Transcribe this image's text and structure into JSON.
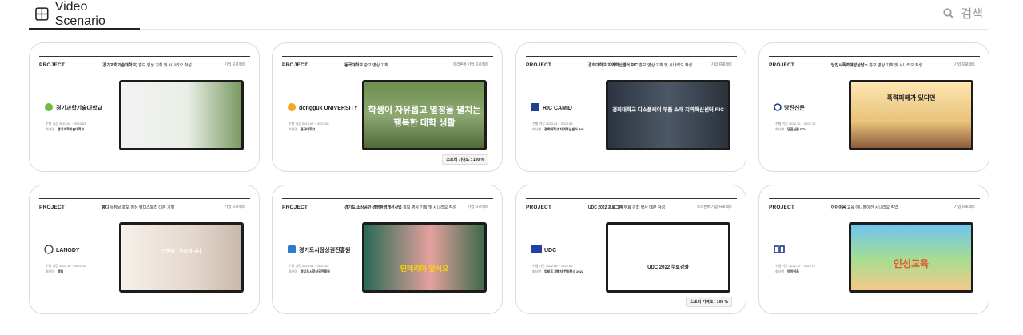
{
  "header": {
    "tab_label": "Video Scenario",
    "search_placeholder": "검색"
  },
  "cards": [
    {
      "project": "PROJECT",
      "title_bold": "[경기과학기술대학교]",
      "title_rest": " 홍보 영상 기획 및 시나리오 작성",
      "category": "기업 프로젝트",
      "logo_text": "경기과학기술대학교",
      "period": "수행 기간 2023.02 ~ 2023.03",
      "client_label": "회사명",
      "client": "경기과학기술대학교",
      "shot_text": "",
      "badge": ""
    },
    {
      "project": "PROJECT",
      "title_bold": "동국대학교",
      "title_rest": " 광고 영상 기획",
      "category": "트리온버 기업 프로젝트",
      "logo_text": "dongguk UNIVERSITY",
      "period": "수행 기간 2023.07 ~ 2023.08",
      "client_label": "회사명",
      "client": "동국대학교",
      "shot_text": "학생이 자유롭고 열정을 펼치는 행복한 대학 생활",
      "badge": "스토리 기여도 : 100 %"
    },
    {
      "project": "PROJECT",
      "title_bold": "경희대학교 지역혁신센터 RIC",
      "title_rest": " 홍보 영상 기획 및 시나리오 작성",
      "category": "기업 프로젝트",
      "logo_text": "RIC CAMID",
      "period": "수행 기간 2023.03 ~ 2023.03",
      "client_label": "회사명",
      "client": "경희대학교 지역혁신센터 RIC",
      "shot_text": "경희대학교 디스플레이 부품 소재 지역혁신센터 RIC",
      "badge": ""
    },
    {
      "project": "PROJECT",
      "title_bold": "당진시폭력예방상담소",
      "title_rest": " 홍보 영상 기획 및 시나리오 작성",
      "category": "기업 프로젝트",
      "logo_text": "당진신문",
      "period": "수행 기간 2022.10 ~ 2022.12",
      "client_label": "회사명",
      "client": "당진신문 DTV",
      "shot_text": "폭력피해가 있다면",
      "badge": ""
    },
    {
      "project": "PROJECT",
      "title_bold": "랭디",
      "title_rest": " 유튜브 홍보 영상 랭디스토리 대본 기획",
      "category": "기업 프로젝트",
      "logo_text": "LANGDY",
      "period": "수행 기간 2022.10 ~ 2022.11",
      "client_label": "회사명",
      "client": "랭디",
      "shot_text": "선생님 · 부모입니다",
      "badge": ""
    },
    {
      "project": "PROJECT",
      "title_bold": "경기도 소상공인 경영환경개선사업",
      "title_rest": " 홍보 영상 기획 및 시나리오 작성",
      "category": "기업 프로젝트",
      "logo_text": "경기도시장상권진흥원",
      "period": "수행 기간 2023.01 ~ 2023.02",
      "client_label": "회사명",
      "client": "경기도시장상권진흥원",
      "shot_text": "인테리어 앞서요",
      "badge": ""
    },
    {
      "project": "PROJECT",
      "title_bold": "UDC 2022 프로그램",
      "title_rest": " 무료 강좌 행사 대본 작성",
      "category": "트리온버 기업 프로젝트",
      "logo_text": "UDC",
      "period": "수행 기간 2022.06 ~ 2022.06",
      "client_label": "회사명",
      "client": "업비트 개발자 컨퍼런스 2022",
      "shot_text": "UDC 2022 무료강좌",
      "badge": "스토리 기여도 : 100 %"
    },
    {
      "project": "PROJECT",
      "title_bold": "아이이음",
      "title_rest": " 교육 애니메이션 시나리오 작업",
      "category": "기업 프로젝트",
      "logo_text": "",
      "period": "수행 기간 2022.11 ~ 2022.12",
      "client_label": "회사명",
      "client": "아이이음",
      "shot_text": "인성교육",
      "badge": ""
    }
  ]
}
